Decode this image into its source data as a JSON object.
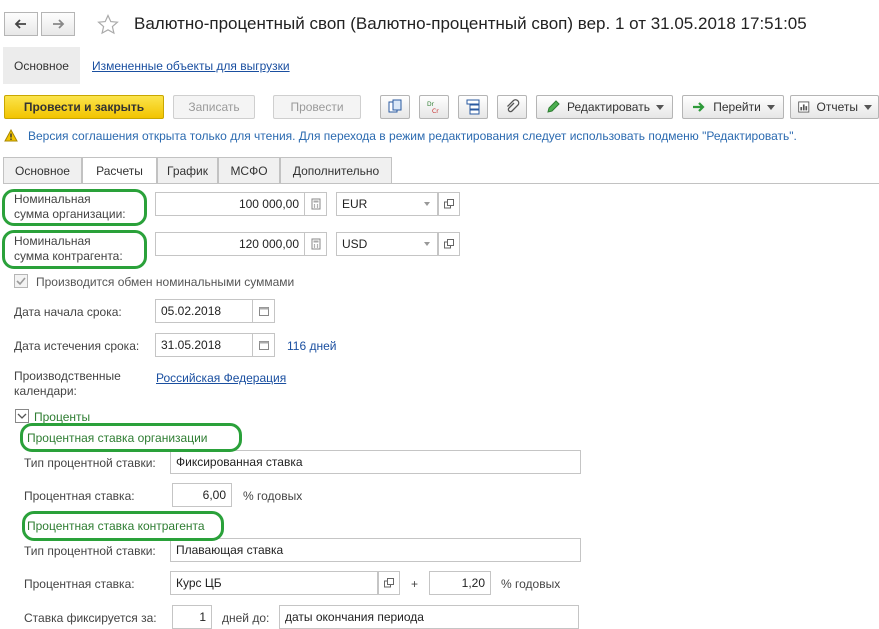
{
  "window": {
    "title": "Валютно-процентный своп (Валютно-процентный своп) вер. 1 от 31.05.2018 17:51:05"
  },
  "sections": {
    "main": "Основное",
    "changed_objects": "Измененные объекты для выгрузки"
  },
  "toolbar": {
    "post_close": "Провести и закрыть",
    "save": "Записать",
    "post": "Провести",
    "edit": "Редактировать",
    "goto": "Перейти",
    "reports": "Отчеты"
  },
  "warning": {
    "text": "Версия соглашения открыта только для чтения. Для перехода в режим редактирования следует использовать подменю \"Редактировать\"."
  },
  "tabs": [
    "Основное",
    "Расчеты",
    "График",
    "МСФО",
    "Дополнительно"
  ],
  "form": {
    "nominal_org_label_1": "Номинальная",
    "nominal_org_label_2": "сумма организации:",
    "nominal_org_value": "100 000,00",
    "nominal_org_currency": "EUR",
    "nominal_cp_label_1": "Номинальная",
    "nominal_cp_label_2": "сумма контрагента:",
    "nominal_cp_value": "120 000,00",
    "nominal_cp_currency": "USD",
    "exchange_label": "Производится обмен номинальными суммами",
    "exchange_checked": true,
    "start_date_label": "Дата начала срока:",
    "start_date": "05.02.2018",
    "end_date_label": "Дата истечения срока:",
    "end_date": "31.05.2018",
    "days": "116 дней",
    "calendars_label_1": "Производственные",
    "calendars_label_2": "календари:",
    "calendars_value": "Российская Федерация",
    "percents_group": "Проценты",
    "org_rate_header": "Процентная ставка организации",
    "org_rate_type_label": "Тип процентной ставки:",
    "org_rate_type": "Фиксированная ставка",
    "org_rate_label": "Процентная ставка:",
    "org_rate_value": "6,00",
    "org_rate_unit": "% годовых",
    "cp_rate_header": "Процентная ставка контрагента",
    "cp_rate_type_label": "Тип процентной ставки:",
    "cp_rate_type": "Плавающая ставка",
    "cp_rate_label": "Процентная ставка:",
    "cp_rate_base": "Курс ЦБ",
    "cp_rate_plus": "+",
    "cp_rate_add": "1,20",
    "cp_rate_unit": "% годовых",
    "fix_label": "Ставка фиксируется за:",
    "fix_days": "1",
    "fix_days_label": "дней до:",
    "fix_until": "даты окончания периода"
  },
  "colors": {
    "primary_button": "#f2c400",
    "link": "#1a4fa0",
    "highlight": "#2aa13a",
    "group_header": "#2e7d32"
  }
}
